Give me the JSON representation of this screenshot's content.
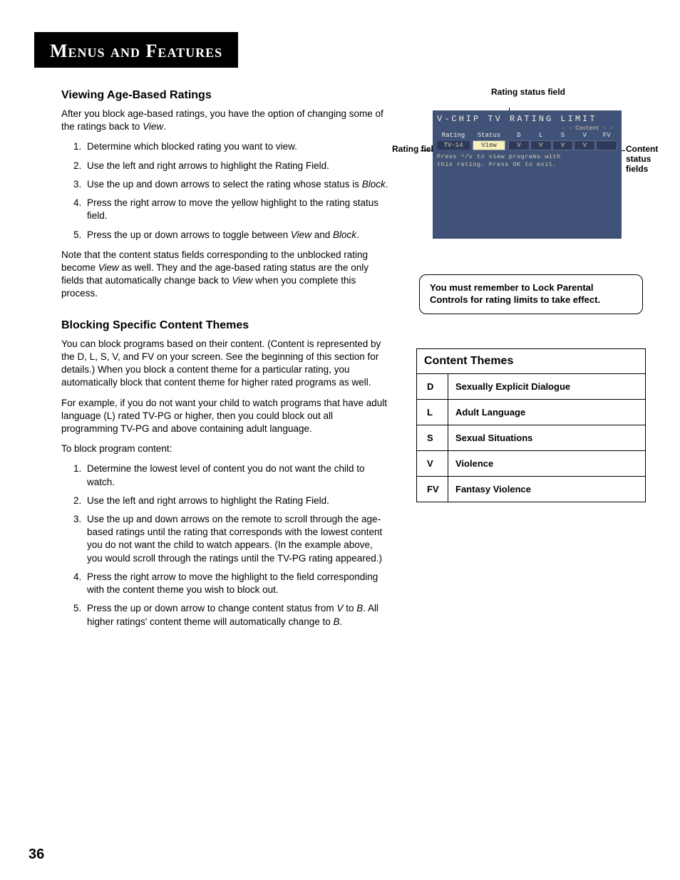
{
  "header_title": "Menus and Features",
  "section1": {
    "heading": "Viewing Age-Based Ratings",
    "intro_a": "After you block age-based ratings, you have the option of changing some of the ratings back to ",
    "intro_term": "View",
    "intro_b": ".",
    "steps": [
      "Determine which blocked rating you want to view.",
      "Use the left and right arrows to highlight the Rating Field.",
      "Use the up and down arrows to select the rating whose status is Block.",
      "Press the right arrow to move the yellow highlight to the rating status field.",
      "Press the up or down arrows to toggle between View and Block."
    ],
    "note_a": "Note that the content status fields corresponding to the unblocked rating become ",
    "note_term1": "View",
    "note_b": " as well. They and the age-based rating status are the only fields that automatically change back to ",
    "note_term2": "View",
    "note_c": " when you complete this process."
  },
  "section2": {
    "heading": "Blocking Specific Content Themes",
    "p1": "You can block programs based on their content. (Content is represented by the D, L, S, V, and FV on your screen. See the beginning of this section for details.) When you block a content theme for a particular rating, you automatically block that content theme for higher rated programs as well.",
    "p2": "For example, if you do not want your child to watch programs that have adult language (L) rated TV-PG or higher, then you could block out all programming TV-PG and above containing adult language.",
    "p3": "To block program content:",
    "steps": [
      "Determine the lowest level of content you do not want the child to watch.",
      "Use the left and right arrows to highlight the Rating Field.",
      "Use the up and down arrows on the remote to scroll through the age-based ratings until the rating that corresponds with the lowest content you do not want the child to watch appears.  (In the example above, you would scroll through the ratings until the TV-PG rating appeared.)",
      "Press the right arrow to move the highlight to the field corresponding with the content theme you wish to block out.",
      "Press the up or down arrow to change content status from V to B. All higher ratings' content theme will automatically change to B."
    ]
  },
  "figure": {
    "label_top": "Rating status field",
    "label_left": "Rating field",
    "label_right": "Content status fields",
    "tv_title": "V-CHIP TV RATING LIMIT",
    "tv_sub": "- - Content - -",
    "tv_head_rating": "Rating",
    "tv_head_status": "Status",
    "tv_head_cols": [
      "D",
      "L",
      "S",
      "V",
      "FV"
    ],
    "tv_row_rating": "TV-14",
    "tv_row_status": "View",
    "tv_row_vals": [
      "V",
      "V",
      "V",
      "V",
      ""
    ],
    "tv_note1": "Press ^/v to view programs with",
    "tv_note2": "this rating. Press OK to exit."
  },
  "note_box": "You must remember to Lock Parental Controls for rating limits to take effect.",
  "themes": {
    "title": "Content Themes",
    "rows": [
      {
        "code": "D",
        "desc": "Sexually Explicit Dialogue"
      },
      {
        "code": "L",
        "desc": "Adult Language"
      },
      {
        "code": "S",
        "desc": "Sexual Situations"
      },
      {
        "code": "V",
        "desc": "Violence"
      },
      {
        "code": "FV",
        "desc": "Fantasy Violence"
      }
    ]
  },
  "page_number": "36"
}
